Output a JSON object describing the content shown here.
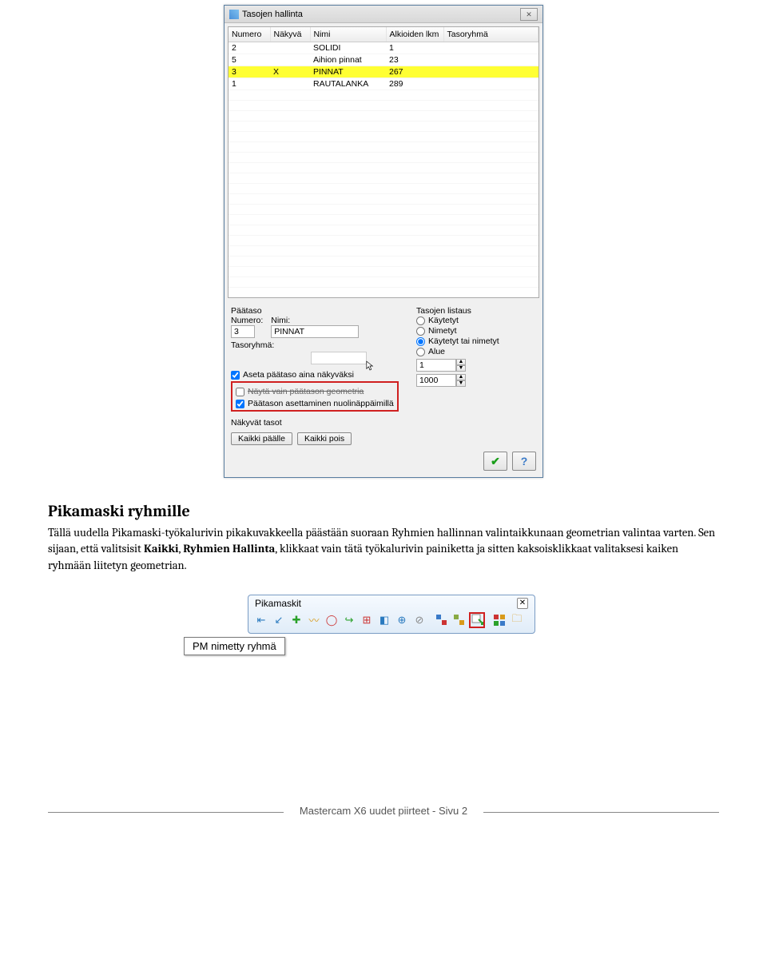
{
  "dialog": {
    "title": "Tasojen hallinta",
    "columns": [
      "Numero",
      "Näkyvä",
      "Nimi",
      "Alkioiden lkm",
      "Tasoryhmä"
    ],
    "rows": [
      {
        "numero": "2",
        "nakyva": "",
        "nimi": "SOLIDI",
        "alkiot": "1",
        "ryhma": "",
        "hl": false
      },
      {
        "numero": "5",
        "nakyva": "",
        "nimi": "Aihion pinnat",
        "alkiot": "23",
        "ryhma": "",
        "hl": false
      },
      {
        "numero": "3",
        "nakyva": "X",
        "nimi": "PINNAT",
        "alkiot": "267",
        "ryhma": "",
        "hl": true
      },
      {
        "numero": "1",
        "nakyva": "",
        "nimi": "RAUTALANKA",
        "alkiot": "289",
        "ryhma": "",
        "hl": false
      }
    ],
    "paataso_label": "Päätaso",
    "numero_label": "Numero:",
    "nimi_label": "Nimi:",
    "numero_value": "3",
    "nimi_value": "PINNAT",
    "tasoryhma_label": "Tasoryhmä:",
    "checkbox1": "Aseta päätaso aina näkyväksi",
    "checkbox2_struck": "Näytä vain päätason geometria",
    "checkbox3": "Päätason asettaminen nuolinäppäimillä",
    "tasojen_listaus": "Tasojen listaus",
    "radio1": "Käytetyt",
    "radio2": "Nimetyt",
    "radio3": "Käytetyt tai nimetyt",
    "radio4": "Alue",
    "range_from": "1",
    "range_to": "1000",
    "nakyvat_tasot": "Näkyvät tasot",
    "kaikki_paalle": "Kaikki päälle",
    "kaikki_pois": "Kaikki pois"
  },
  "heading": "Pikamaski ryhmille",
  "paragraph_parts": {
    "p1": "Tällä uudella Pikamaski-työkalurivin pikakuvakkeella päästään suoraan Ryhmien hallinnan valintaikkunaan geometrian valintaa varten. Sen sijaan, että valitsisit ",
    "bold1": "Kaikki",
    "p2": ", ",
    "bold2": "Ryhmien Hallinta",
    "p3": ", klikkaat vain tätä työkalurivin painiketta ja sitten kaksoisklikkaat valitaksesi kaiken ryhmään liitetyn geometrian."
  },
  "pikamaskit": {
    "title": "Pikamaskit",
    "tooltip": "PM nimetty ryhmä"
  },
  "footer": "Mastercam X6 uudet piirteet - Sivu 2"
}
